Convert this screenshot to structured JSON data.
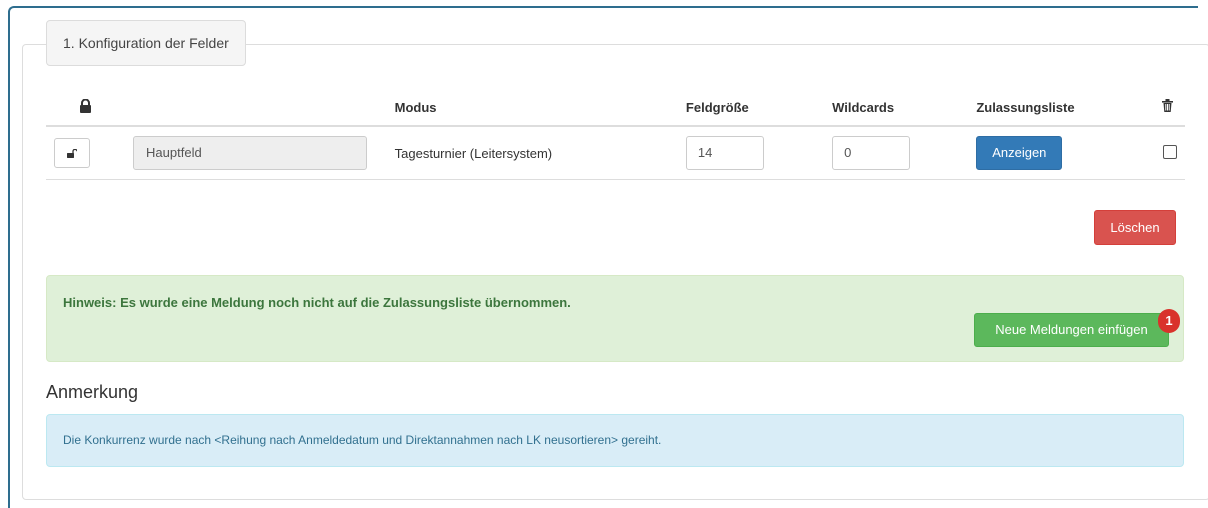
{
  "header_snippet": "",
  "legend": "1. Konfiguration der Felder",
  "table": {
    "headers": {
      "lock": "lock-icon",
      "name": "",
      "mode": "Modus",
      "size": "Feldgröße",
      "wildcards": "Wildcards",
      "list": "Zulassungsliste",
      "delete": "trash-icon"
    },
    "rows": [
      {
        "name": "Hauptfeld",
        "mode": "Tagesturnier (Leitersystem)",
        "size": "14",
        "wildcards": "0",
        "list_button": "Anzeigen",
        "selected": false
      }
    ]
  },
  "delete_button": "Löschen",
  "notice": {
    "text": "Hinweis: Es wurde eine Meldung noch nicht auf die Zulassungsliste übernommen.",
    "button": "Neue Meldungen einfügen",
    "badge": "1"
  },
  "remark": {
    "heading": "Anmerkung",
    "text": "Die Konkurrenz wurde nach <Reihung nach Anmeldedatum und Direktannahmen nach LK neusortieren> gereiht."
  },
  "colors": {
    "primary": "#337ab7",
    "danger": "#d9534f",
    "success": "#5cb85c",
    "badge": "#d9322b",
    "success_bg": "#dff0d8",
    "info_bg": "#d9edf7"
  }
}
